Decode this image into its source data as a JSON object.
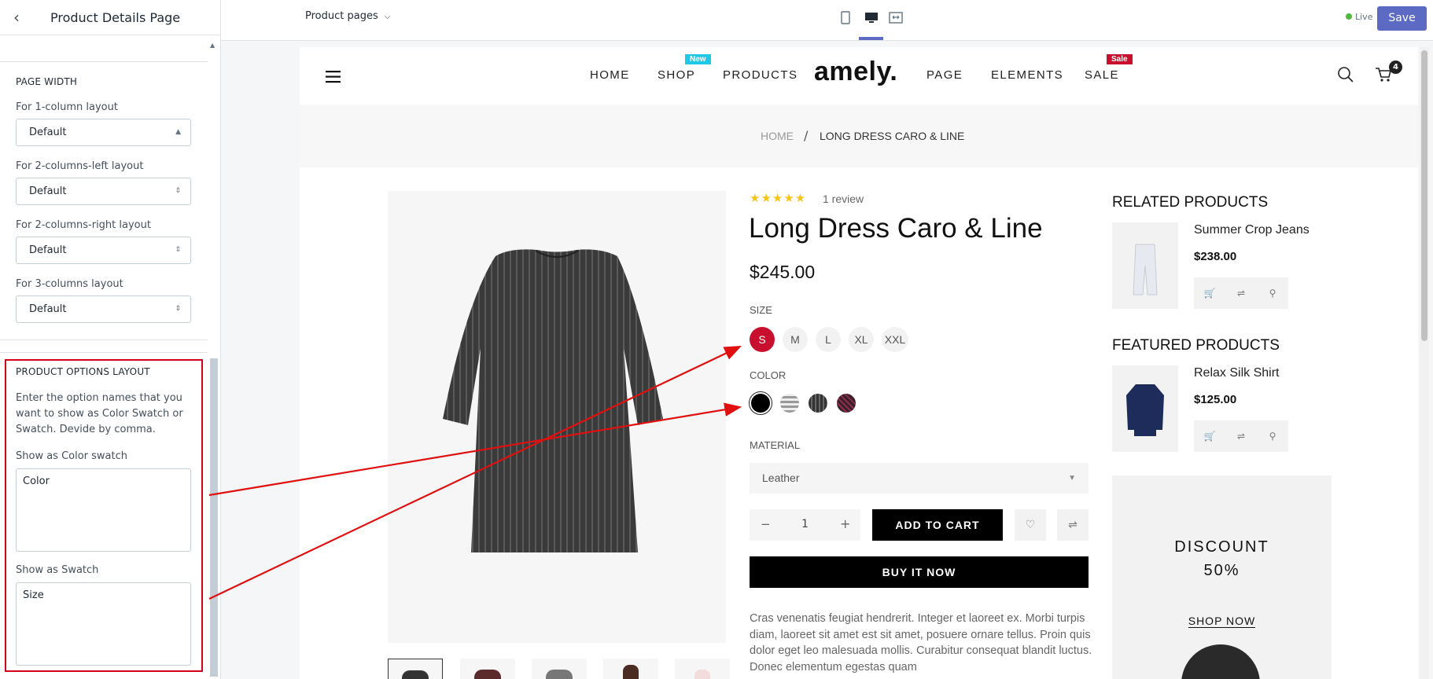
{
  "editor": {
    "page_title": "Product Details Page",
    "template_selector": "Product pages",
    "live_label": "Live",
    "save_label": "Save",
    "colors": {
      "save": "#5c6ac4",
      "live_dot": "#50b83c",
      "highlight": "#d0021b"
    }
  },
  "sidebar": {
    "page_width": {
      "title": "PAGE WIDTH",
      "fields": [
        {
          "label": "For 1-column layout",
          "value": "Default"
        },
        {
          "label": "For 2-columns-left layout",
          "value": "Default"
        },
        {
          "label": "For 2-columns-right layout",
          "value": "Default"
        },
        {
          "label": "For 3-columns layout",
          "value": "Default"
        }
      ]
    },
    "options_layout": {
      "title": "PRODUCT OPTIONS LAYOUT",
      "description": "Enter the option names that you want to show as Color Swatch or Swatch. Devide by comma.",
      "color_swatch_label": "Show as Color swatch",
      "color_swatch_value": "Color",
      "swatch_label": "Show as Swatch",
      "swatch_value": "Size"
    }
  },
  "store": {
    "logo": "amely.",
    "cart_count": "4",
    "nav": [
      "HOME",
      "SHOP",
      "PRODUCTS",
      "PAGE",
      "ELEMENTS",
      "SALE"
    ],
    "badges": {
      "shop": "New",
      "sale": "Sale"
    },
    "breadcrumb": {
      "home": "HOME",
      "separator": "/",
      "current": "LONG DRESS CARO & LINE"
    },
    "product": {
      "rating_text": "1 review",
      "rating_stars": 5,
      "title": "Long Dress Caro & Line",
      "price": "$245.00",
      "size_label": "SIZE",
      "sizes": [
        "S",
        "M",
        "L",
        "XL",
        "XXL"
      ],
      "selected_size": "S",
      "color_label": "COLOR",
      "material_label": "MATERIAL",
      "material_value": "Leather",
      "quantity": "1",
      "add_to_cart": "ADD TO CART",
      "buy_now": "BUY IT NOW",
      "description": "Cras venenatis feugiat hendrerit. Integer et laoreet ex. Morbi turpis diam, laoreet sit amet est sit amet, posuere ornare tellus. Proin quis dolor eget leo malesuada mollis. Curabitur consequat blandit luctus. Donec elementum egestas quam"
    },
    "related": {
      "title": "RELATED PRODUCTS",
      "item_name": "Summer Crop Jeans",
      "item_price": "$238.00"
    },
    "featured": {
      "title": "FEATURED PRODUCTS",
      "item_name": "Relax Silk Shirt",
      "item_price": "$125.00"
    },
    "promo": {
      "line1": "DISCOUNT",
      "line2": "50%",
      "cta": "SHOP NOW"
    },
    "colors": {
      "badge_new": "#1fc8e6",
      "badge_sale": "#c8102e",
      "selected_size": "#c8102e",
      "star": "#f5c518"
    }
  }
}
